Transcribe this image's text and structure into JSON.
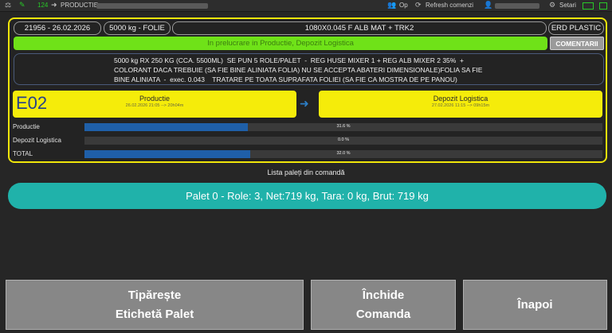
{
  "topbar": {
    "count": "124",
    "app": "PRODUCTIE -",
    "op_label": "Op",
    "refresh_label": "Refresh comenzi",
    "settings_label": "Setari"
  },
  "order": {
    "id_date": "21956 - 26.02.2026",
    "qty_type": "5000 kg - FOLIE",
    "spec": "1080X0.045 F ALB MAT + TRK2",
    "client": "ERD PLASTIC",
    "status": "In prelucrare in Productie, Depozit Logistica",
    "comments_button": "COMENTARII",
    "notes": [
      "5000 kg RX 250 KG (CCA. 5500ML)  SE PUN 5 ROLE/PALET  -  REG HUSE MIXER 1 + REG ALB MIXER 2 35%  +",
      "COLORANT DACA TREBUIE (SA FIE BINE ALINIATA FOLIA) NU SE ACCEPTA ABATERI DIMENSIONALE)FOLIA SA FIE",
      "BINE ALINIATA  -  exec. 0.043    TRATARE PE TOATA SUPRAFATA FOLIEI (SA FIE CA MOSTRA DE PE PANOU)"
    ]
  },
  "stages": {
    "code": "E02",
    "production": {
      "title": "Productie",
      "detail": "26.02.2026 21:05 --> 20h04m"
    },
    "logistics": {
      "title": "Depozit Logistica",
      "detail": "27.02.2026 11:15 --> 09h15m"
    }
  },
  "progress": [
    {
      "label": "Productie",
      "value": 0.316,
      "text": "31.6 %"
    },
    {
      "label": "Depozit Logistica",
      "value": 0.0,
      "text": "0.0 %"
    },
    {
      "label": "TOTAL",
      "value": 0.32,
      "text": "32.0 %"
    }
  ],
  "pallets": {
    "title": "Lista paleți din comandă",
    "items": [
      "Palet 0 - Role: 3, Net:719 kg, Tara: 0 kg, Brut: 719 kg"
    ]
  },
  "buttons": {
    "print_line1": "Tipărește",
    "print_line2": "Etichetă Palet",
    "close_line1": "Închide",
    "close_line2": "Comanda",
    "back": "Înapoi"
  },
  "colors": {
    "panel_border": "#f0e60a",
    "status_bar": "#6fe218",
    "stage_box": "#f5ec0a",
    "progress_fill": "#1f5fa8",
    "pallet_row": "#20b2aa"
  }
}
